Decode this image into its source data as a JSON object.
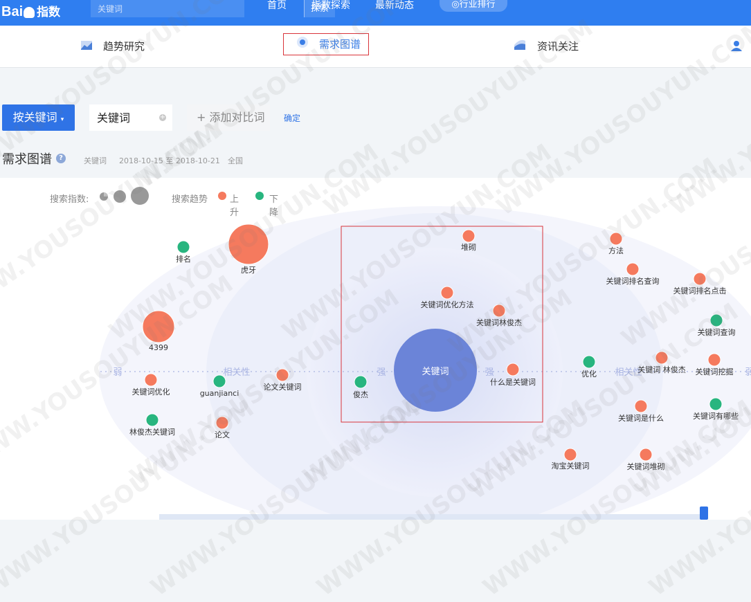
{
  "header": {
    "logo_text": "Bai",
    "logo_cn": "指数",
    "search_placeholder": "关键词",
    "search_button": "探索",
    "nav": [
      "首页",
      "指数探索",
      "最新动态"
    ],
    "rank_button": "行业排行"
  },
  "tabs": [
    {
      "label": "趋势研究",
      "icon": "trend-chart-icon"
    },
    {
      "label": "需求图谱",
      "icon": "radar-target-icon"
    },
    {
      "label": "资讯关注",
      "icon": "news-icon"
    }
  ],
  "filter": {
    "mode_button": "按关键词",
    "keyword": "关键词",
    "add_compare": "+ 添加对比词",
    "confirm": "确定"
  },
  "section": {
    "title": "需求图谱",
    "keyword": "关键词",
    "date_range": "2018-10-15 至 2018-10-21",
    "region": "全国"
  },
  "legend": {
    "search_index_label": "搜索指数:",
    "search_trend_label": "搜索趋势",
    "up_label": "上升",
    "down_label": "下降"
  },
  "colors": {
    "up": "#f57a5e",
    "down": "#28b57f",
    "center": "#6b84d8",
    "accent": "#2f73e6"
  },
  "axis_labels": {
    "left_strong": "弱",
    "left_relevance": "相关性",
    "center_left": "强",
    "center_right": "强",
    "right_relevance": "相关性",
    "right_weak": "弱"
  },
  "chart_data": {
    "type": "scatter",
    "center": {
      "label": "关键词"
    },
    "nodes": [
      {
        "label": "排名",
        "trend": "down",
        "size": "small"
      },
      {
        "label": "虎牙",
        "trend": "up",
        "size": "large"
      },
      {
        "label": "4399",
        "trend": "up",
        "size": "medium"
      },
      {
        "label": "关键词优化",
        "trend": "up",
        "size": "small"
      },
      {
        "label": "guanjianci",
        "trend": "down",
        "size": "small"
      },
      {
        "label": "论文关键词",
        "trend": "up",
        "size": "small"
      },
      {
        "label": "林俊杰关键词",
        "trend": "down",
        "size": "small"
      },
      {
        "label": "论文",
        "trend": "up",
        "size": "small"
      },
      {
        "label": "堆砌",
        "trend": "up",
        "size": "small"
      },
      {
        "label": "关键词优化方法",
        "trend": "up",
        "size": "small"
      },
      {
        "label": "关键词林俊杰",
        "trend": "up",
        "size": "small"
      },
      {
        "label": "俊杰",
        "trend": "down",
        "size": "small"
      },
      {
        "label": "什么是关键词",
        "trend": "up",
        "size": "small"
      },
      {
        "label": "方法",
        "trend": "up",
        "size": "small"
      },
      {
        "label": "关键词排名查询",
        "trend": "up",
        "size": "small"
      },
      {
        "label": "关键词排名点击",
        "trend": "up",
        "size": "small"
      },
      {
        "label": "关键词查询",
        "trend": "down",
        "size": "small"
      },
      {
        "label": "优化",
        "trend": "down",
        "size": "small"
      },
      {
        "label": "关键词 林俊杰",
        "trend": "up",
        "size": "small"
      },
      {
        "label": "关键词挖掘",
        "trend": "up",
        "size": "small"
      },
      {
        "label": "关键词是什么",
        "trend": "up",
        "size": "small"
      },
      {
        "label": "关键词有哪些",
        "trend": "down",
        "size": "small"
      },
      {
        "label": "淘宝关键词",
        "trend": "up",
        "size": "small"
      },
      {
        "label": "关键词堆砌",
        "trend": "up",
        "size": "small"
      }
    ]
  },
  "watermark": "WWW.YOUSOUYUN.COM"
}
